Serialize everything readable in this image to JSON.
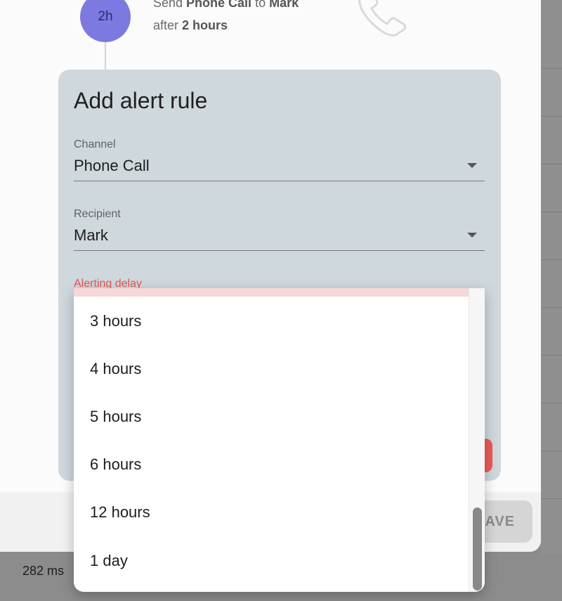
{
  "background": {
    "timing": "282 ms"
  },
  "step": {
    "badge": "2h",
    "line1_pre": "Send ",
    "line1_channel": "Phone Call",
    "line1_mid": " to ",
    "line1_recipient": "Mark",
    "line2_pre": "after ",
    "line2_delay": "2 hours",
    "icon": "phone-icon"
  },
  "card": {
    "title": "Add alert rule",
    "channel": {
      "label": "Channel",
      "value": "Phone Call"
    },
    "recipient": {
      "label": "Recipient",
      "value": "Mark"
    },
    "delay": {
      "label": "Alerting delay"
    }
  },
  "footer": {
    "save_label": "AVE"
  },
  "dropdown": {
    "options": [
      "3 hours",
      "4 hours",
      "5 hours",
      "6 hours",
      "12 hours",
      "1 day"
    ]
  },
  "colors": {
    "accent": "#7c79e0",
    "error": "#e55555",
    "card_bg": "#cfd8dd"
  }
}
